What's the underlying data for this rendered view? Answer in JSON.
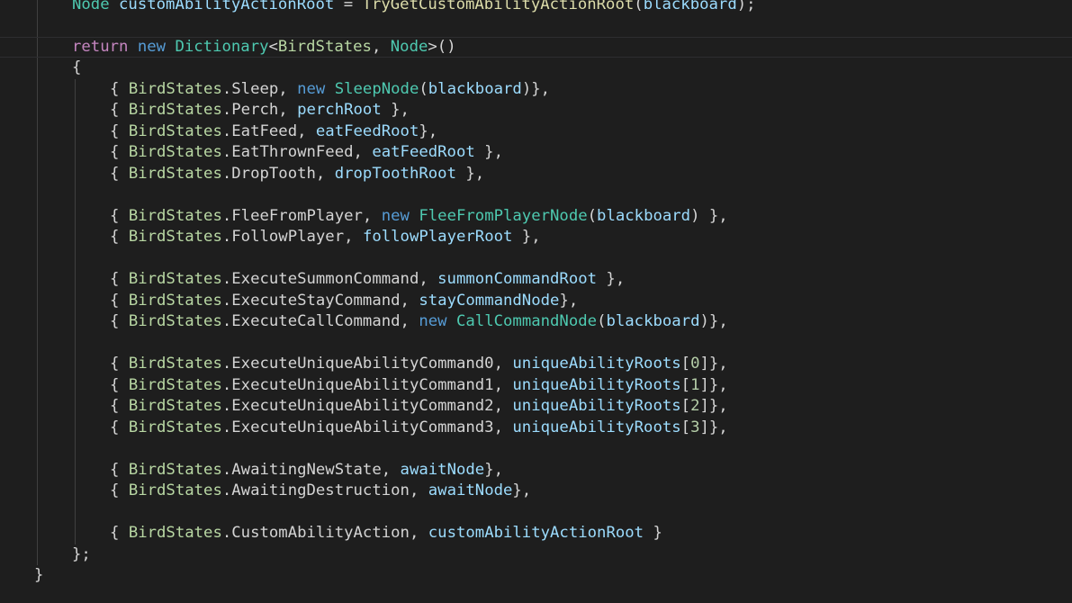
{
  "editor": {
    "language": "csharp",
    "theme_colors": {
      "background": "#1e1e1e",
      "keyword": "#569cd6",
      "control_keyword": "#c586c0",
      "type": "#4ec9b0",
      "enum_member": "#b8d7a3",
      "variable": "#9cdcfe",
      "function": "#dcdcaa",
      "number": "#b5cea8",
      "text": "#d4d4d4"
    },
    "current_line_index": 2,
    "lines": [
      {
        "indent": 2,
        "tokens": [
          {
            "t": "Node",
            "c": "type"
          },
          {
            "t": " ",
            "c": "plain"
          },
          {
            "t": "customAbilityActionRoot",
            "c": "var"
          },
          {
            "t": " = ",
            "c": "plain"
          },
          {
            "t": "TryGetCustomAbilityActionRoot",
            "c": "fn"
          },
          {
            "t": "(",
            "c": "plain"
          },
          {
            "t": "blackboard",
            "c": "var"
          },
          {
            "t": ");",
            "c": "plain"
          }
        ]
      },
      {
        "indent": 0,
        "tokens": []
      },
      {
        "indent": 2,
        "tokens": [
          {
            "t": "return",
            "c": "ctl"
          },
          {
            "t": " ",
            "c": "plain"
          },
          {
            "t": "new",
            "c": "kw"
          },
          {
            "t": " ",
            "c": "plain"
          },
          {
            "t": "Dictionary",
            "c": "type"
          },
          {
            "t": "<",
            "c": "plain"
          },
          {
            "t": "BirdStates",
            "c": "enum"
          },
          {
            "t": ", ",
            "c": "plain"
          },
          {
            "t": "Node",
            "c": "type"
          },
          {
            "t": ">()",
            "c": "plain"
          }
        ]
      },
      {
        "indent": 2,
        "tokens": [
          {
            "t": "{",
            "c": "plain"
          }
        ]
      },
      {
        "indent": 3,
        "tokens": [
          {
            "t": "{ ",
            "c": "plain"
          },
          {
            "t": "BirdStates",
            "c": "enum"
          },
          {
            "t": ".Sleep, ",
            "c": "plain"
          },
          {
            "t": "new",
            "c": "kw"
          },
          {
            "t": " ",
            "c": "plain"
          },
          {
            "t": "SleepNode",
            "c": "type"
          },
          {
            "t": "(",
            "c": "plain"
          },
          {
            "t": "blackboard",
            "c": "var"
          },
          {
            "t": ")},",
            "c": "plain"
          }
        ]
      },
      {
        "indent": 3,
        "tokens": [
          {
            "t": "{ ",
            "c": "plain"
          },
          {
            "t": "BirdStates",
            "c": "enum"
          },
          {
            "t": ".Perch, ",
            "c": "plain"
          },
          {
            "t": "perchRoot",
            "c": "var"
          },
          {
            "t": " },",
            "c": "plain"
          }
        ]
      },
      {
        "indent": 3,
        "tokens": [
          {
            "t": "{ ",
            "c": "plain"
          },
          {
            "t": "BirdStates",
            "c": "enum"
          },
          {
            "t": ".EatFeed, ",
            "c": "plain"
          },
          {
            "t": "eatFeedRoot",
            "c": "var"
          },
          {
            "t": "},",
            "c": "plain"
          }
        ]
      },
      {
        "indent": 3,
        "tokens": [
          {
            "t": "{ ",
            "c": "plain"
          },
          {
            "t": "BirdStates",
            "c": "enum"
          },
          {
            "t": ".EatThrownFeed, ",
            "c": "plain"
          },
          {
            "t": "eatFeedRoot",
            "c": "var"
          },
          {
            "t": " },",
            "c": "plain"
          }
        ]
      },
      {
        "indent": 3,
        "tokens": [
          {
            "t": "{ ",
            "c": "plain"
          },
          {
            "t": "BirdStates",
            "c": "enum"
          },
          {
            "t": ".DropTooth, ",
            "c": "plain"
          },
          {
            "t": "dropToothRoot",
            "c": "var"
          },
          {
            "t": " },",
            "c": "plain"
          }
        ]
      },
      {
        "indent": 0,
        "tokens": []
      },
      {
        "indent": 3,
        "tokens": [
          {
            "t": "{ ",
            "c": "plain"
          },
          {
            "t": "BirdStates",
            "c": "enum"
          },
          {
            "t": ".FleeFromPlayer, ",
            "c": "plain"
          },
          {
            "t": "new",
            "c": "kw"
          },
          {
            "t": " ",
            "c": "plain"
          },
          {
            "t": "FleeFromPlayerNode",
            "c": "type"
          },
          {
            "t": "(",
            "c": "plain"
          },
          {
            "t": "blackboard",
            "c": "var"
          },
          {
            "t": ") },",
            "c": "plain"
          }
        ]
      },
      {
        "indent": 3,
        "tokens": [
          {
            "t": "{ ",
            "c": "plain"
          },
          {
            "t": "BirdStates",
            "c": "enum"
          },
          {
            "t": ".FollowPlayer, ",
            "c": "plain"
          },
          {
            "t": "followPlayerRoot",
            "c": "var"
          },
          {
            "t": " },",
            "c": "plain"
          }
        ]
      },
      {
        "indent": 0,
        "tokens": []
      },
      {
        "indent": 3,
        "tokens": [
          {
            "t": "{ ",
            "c": "plain"
          },
          {
            "t": "BirdStates",
            "c": "enum"
          },
          {
            "t": ".ExecuteSummonCommand, ",
            "c": "plain"
          },
          {
            "t": "summonCommandRoot",
            "c": "var"
          },
          {
            "t": " },",
            "c": "plain"
          }
        ]
      },
      {
        "indent": 3,
        "tokens": [
          {
            "t": "{ ",
            "c": "plain"
          },
          {
            "t": "BirdStates",
            "c": "enum"
          },
          {
            "t": ".ExecuteStayCommand, ",
            "c": "plain"
          },
          {
            "t": "stayCommandNode",
            "c": "var"
          },
          {
            "t": "},",
            "c": "plain"
          }
        ]
      },
      {
        "indent": 3,
        "tokens": [
          {
            "t": "{ ",
            "c": "plain"
          },
          {
            "t": "BirdStates",
            "c": "enum"
          },
          {
            "t": ".ExecuteCallCommand, ",
            "c": "plain"
          },
          {
            "t": "new",
            "c": "kw"
          },
          {
            "t": " ",
            "c": "plain"
          },
          {
            "t": "CallCommandNode",
            "c": "type"
          },
          {
            "t": "(",
            "c": "plain"
          },
          {
            "t": "blackboard",
            "c": "var"
          },
          {
            "t": ")},",
            "c": "plain"
          }
        ]
      },
      {
        "indent": 0,
        "tokens": []
      },
      {
        "indent": 3,
        "tokens": [
          {
            "t": "{ ",
            "c": "plain"
          },
          {
            "t": "BirdStates",
            "c": "enum"
          },
          {
            "t": ".ExecuteUniqueAbilityCommand0, ",
            "c": "plain"
          },
          {
            "t": "uniqueAbilityRoots",
            "c": "var"
          },
          {
            "t": "[",
            "c": "plain"
          },
          {
            "t": "0",
            "c": "num"
          },
          {
            "t": "]},",
            "c": "plain"
          }
        ]
      },
      {
        "indent": 3,
        "tokens": [
          {
            "t": "{ ",
            "c": "plain"
          },
          {
            "t": "BirdStates",
            "c": "enum"
          },
          {
            "t": ".ExecuteUniqueAbilityCommand1, ",
            "c": "plain"
          },
          {
            "t": "uniqueAbilityRoots",
            "c": "var"
          },
          {
            "t": "[",
            "c": "plain"
          },
          {
            "t": "1",
            "c": "num"
          },
          {
            "t": "]},",
            "c": "plain"
          }
        ]
      },
      {
        "indent": 3,
        "tokens": [
          {
            "t": "{ ",
            "c": "plain"
          },
          {
            "t": "BirdStates",
            "c": "enum"
          },
          {
            "t": ".ExecuteUniqueAbilityCommand2, ",
            "c": "plain"
          },
          {
            "t": "uniqueAbilityRoots",
            "c": "var"
          },
          {
            "t": "[",
            "c": "plain"
          },
          {
            "t": "2",
            "c": "num"
          },
          {
            "t": "]},",
            "c": "plain"
          }
        ]
      },
      {
        "indent": 3,
        "tokens": [
          {
            "t": "{ ",
            "c": "plain"
          },
          {
            "t": "BirdStates",
            "c": "enum"
          },
          {
            "t": ".ExecuteUniqueAbilityCommand3, ",
            "c": "plain"
          },
          {
            "t": "uniqueAbilityRoots",
            "c": "var"
          },
          {
            "t": "[",
            "c": "plain"
          },
          {
            "t": "3",
            "c": "num"
          },
          {
            "t": "]},",
            "c": "plain"
          }
        ]
      },
      {
        "indent": 0,
        "tokens": []
      },
      {
        "indent": 3,
        "tokens": [
          {
            "t": "{ ",
            "c": "plain"
          },
          {
            "t": "BirdStates",
            "c": "enum"
          },
          {
            "t": ".AwaitingNewState, ",
            "c": "plain"
          },
          {
            "t": "awaitNode",
            "c": "var"
          },
          {
            "t": "},",
            "c": "plain"
          }
        ]
      },
      {
        "indent": 3,
        "tokens": [
          {
            "t": "{ ",
            "c": "plain"
          },
          {
            "t": "BirdStates",
            "c": "enum"
          },
          {
            "t": ".AwaitingDestruction, ",
            "c": "plain"
          },
          {
            "t": "awaitNode",
            "c": "var"
          },
          {
            "t": "},",
            "c": "plain"
          }
        ]
      },
      {
        "indent": 0,
        "tokens": []
      },
      {
        "indent": 3,
        "tokens": [
          {
            "t": "{ ",
            "c": "plain"
          },
          {
            "t": "BirdStates",
            "c": "enum"
          },
          {
            "t": ".CustomAbilityAction, ",
            "c": "plain"
          },
          {
            "t": "customAbilityActionRoot",
            "c": "var"
          },
          {
            "t": " }",
            "c": "plain"
          }
        ]
      },
      {
        "indent": 2,
        "tokens": [
          {
            "t": "};",
            "c": "plain"
          }
        ]
      },
      {
        "indent": 1,
        "tokens": [
          {
            "t": "}",
            "c": "plain"
          }
        ]
      }
    ]
  }
}
